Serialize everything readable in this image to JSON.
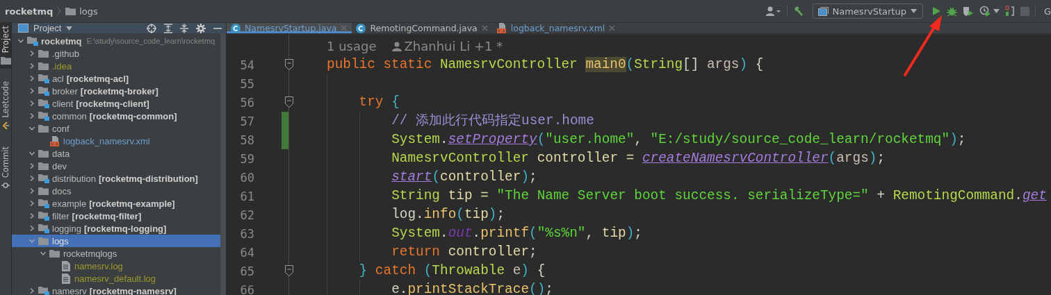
{
  "breadcrumbs": [
    {
      "label": "rocketmq",
      "kind": "project"
    },
    {
      "label": "logs",
      "kind": "folder"
    }
  ],
  "toolbar": {
    "run_configuration": "NamesrvStartup",
    "cut_label": "G"
  },
  "tool_strip": [
    {
      "label": "Project",
      "kind": "project",
      "selected": true
    },
    {
      "label": "Leetcode",
      "kind": "leetcode",
      "selected": false
    },
    {
      "label": "Commit",
      "kind": "commit",
      "selected": false
    }
  ],
  "project_panel": {
    "title": "Project",
    "tree": [
      {
        "name": "rocketmq",
        "path": "E:\\study\\source_code_learn\\rocketmq",
        "kind": "module",
        "color": "#c8c8c8",
        "expanded": true,
        "selected": false,
        "children": [
          {
            "name": ".github",
            "kind": "folder",
            "color": "#bbbbbb",
            "expanded": false,
            "selected": false
          },
          {
            "name": ".idea",
            "kind": "folder",
            "color": "#9a9a2c",
            "expanded": false,
            "selected": false
          },
          {
            "name": "acl",
            "module": "[rocketmq-acl]",
            "kind": "module",
            "color": "#bbbbbb",
            "expanded": false,
            "selected": false
          },
          {
            "name": "broker",
            "module": "[rocketmq-broker]",
            "kind": "module",
            "color": "#bbbbbb",
            "expanded": false,
            "selected": false
          },
          {
            "name": "client",
            "module": "[rocketmq-client]",
            "kind": "module",
            "color": "#bbbbbb",
            "expanded": false,
            "selected": false
          },
          {
            "name": "common",
            "module": "[rocketmq-common]",
            "kind": "module",
            "color": "#bbbbbb",
            "expanded": false,
            "selected": false
          },
          {
            "name": "conf",
            "kind": "folder",
            "color": "#bbbbbb",
            "expanded": true,
            "selected": false,
            "children": [
              {
                "name": "logback_namesrv.xml",
                "kind": "xml",
                "color": "#6d9fce",
                "selected": false
              }
            ]
          },
          {
            "name": "data",
            "kind": "folder",
            "color": "#bbbbbb",
            "expanded": true,
            "selected": false
          },
          {
            "name": "dev",
            "kind": "folder",
            "color": "#bbbbbb",
            "expanded": false,
            "selected": false
          },
          {
            "name": "distribution",
            "module": "[rocketmq-distribution]",
            "kind": "module",
            "color": "#bbbbbb",
            "expanded": false,
            "selected": false
          },
          {
            "name": "docs",
            "kind": "folder",
            "color": "#bbbbbb",
            "expanded": false,
            "selected": false
          },
          {
            "name": "example",
            "module": "[rocketmq-example]",
            "kind": "module",
            "color": "#bbbbbb",
            "expanded": false,
            "selected": false
          },
          {
            "name": "filter",
            "module": "[rocketmq-filter]",
            "kind": "module",
            "color": "#bbbbbb",
            "expanded": false,
            "selected": false
          },
          {
            "name": "logging",
            "module": "[rocketmq-logging]",
            "kind": "module",
            "color": "#bbbbbb",
            "expanded": false,
            "selected": false
          },
          {
            "name": "logs",
            "kind": "folder",
            "expanded": true,
            "selected": true,
            "children": [
              {
                "name": "rocketmqlogs",
                "kind": "folder",
                "color": "#bbbbbb",
                "expanded": true,
                "selected": false,
                "children": [
                  {
                    "name": "namesrv.log",
                    "kind": "log",
                    "color": "#9a9a2c",
                    "selected": false
                  },
                  {
                    "name": "namesrv_default.log",
                    "kind": "log",
                    "color": "#9a9a2c",
                    "selected": false
                  }
                ]
              }
            ]
          },
          {
            "name": "namesrv",
            "module": "[rocketmq-namesrv]",
            "kind": "module",
            "color": "#bbbbbb",
            "expanded": false,
            "selected": false
          }
        ]
      }
    ]
  },
  "editor": {
    "tabs": [
      {
        "label": "NamesrvStartup.java",
        "kind": "java",
        "color": "#6d9fce",
        "selected": true
      },
      {
        "label": "RemotingCommand.java",
        "kind": "java",
        "color": "#bbbbbb",
        "selected": false
      },
      {
        "label": "logback_namesrv.xml",
        "kind": "xml",
        "color": "#6d9fce",
        "selected": false
      }
    ],
    "inlay": {
      "usages": "1 usage",
      "author": "Zhanhui Li +1 *"
    },
    "lines": [
      {
        "number": "54",
        "fold": true,
        "changed": false,
        "tokens": [
          {
            "text": "public static ",
            "kind": "kw"
          },
          {
            "text": "NamesrvController ",
            "kind": "cls"
          },
          {
            "text": "main0",
            "kind": "decl"
          },
          {
            "text": "(",
            "kind": "paren"
          },
          {
            "text": "String",
            "kind": "cls"
          },
          {
            "text": "[] ",
            "kind": "plain"
          },
          {
            "text": "args",
            "kind": "param"
          },
          {
            "text": ")",
            "kind": "paren"
          },
          {
            "text": " {",
            "kind": "plain"
          }
        ],
        "children": [
          {
            "number": "55",
            "fold": false,
            "changed": false
          },
          {
            "number": "56",
            "fold": true,
            "changed": false,
            "tokens": [
              {
                "text": "try ",
                "kind": "kw"
              },
              {
                "text": "{",
                "kind": "paren"
              }
            ],
            "children": [
              {
                "number": "57",
                "fold": false,
                "changed": true,
                "tokens": [
                  {
                    "text": "// 添加此行代码指定user.home",
                    "kind": "comment"
                  }
                ]
              },
              {
                "number": "58",
                "fold": false,
                "changed": true,
                "tokens": [
                  {
                    "text": "System",
                    "kind": "cls"
                  },
                  {
                    "text": ".",
                    "kind": "plain"
                  },
                  {
                    "text": "setProperty",
                    "kind": "static"
                  },
                  {
                    "text": "(",
                    "kind": "paren"
                  },
                  {
                    "text": "\"user.home\"",
                    "kind": "str"
                  },
                  {
                    "text": ", ",
                    "kind": "plain"
                  },
                  {
                    "text": "\"E:/study/source_code_learn/rocketmq\"",
                    "kind": "str"
                  },
                  {
                    "text": ")",
                    "kind": "paren"
                  },
                  {
                    "text": ";",
                    "kind": "plain"
                  }
                ]
              },
              {
                "number": "59",
                "fold": false,
                "changed": false,
                "tokens": [
                  {
                    "text": "NamesrvController",
                    "kind": "cls"
                  },
                  {
                    "text": " controller = ",
                    "kind": "var"
                  },
                  {
                    "text": "createNamesrvController",
                    "kind": "static"
                  },
                  {
                    "text": "(",
                    "kind": "paren"
                  },
                  {
                    "text": "args",
                    "kind": "param"
                  },
                  {
                    "text": ")",
                    "kind": "paren"
                  },
                  {
                    "text": ";",
                    "kind": "plain"
                  }
                ]
              },
              {
                "number": "60",
                "fold": false,
                "changed": false,
                "tokens": [
                  {
                    "text": "start",
                    "kind": "static"
                  },
                  {
                    "text": "(",
                    "kind": "paren"
                  },
                  {
                    "text": "controller",
                    "kind": "var"
                  },
                  {
                    "text": ")",
                    "kind": "paren"
                  },
                  {
                    "text": ";",
                    "kind": "plain"
                  }
                ]
              },
              {
                "number": "61",
                "fold": false,
                "changed": false,
                "tokens": [
                  {
                    "text": "String",
                    "kind": "cls"
                  },
                  {
                    "text": " tip = ",
                    "kind": "var"
                  },
                  {
                    "text": "\"The Name Server boot success. serializeType=\"",
                    "kind": "str"
                  },
                  {
                    "text": " + ",
                    "kind": "plain"
                  },
                  {
                    "text": "RemotingCommand",
                    "kind": "cls"
                  },
                  {
                    "text": ".",
                    "kind": "plain"
                  },
                  {
                    "text": "get",
                    "kind": "static"
                  }
                ]
              },
              {
                "number": "62",
                "fold": false,
                "changed": false,
                "tokens": [
                  {
                    "text": "log.",
                    "kind": "plain"
                  },
                  {
                    "text": "info",
                    "kind": "call"
                  },
                  {
                    "text": "(",
                    "kind": "paren"
                  },
                  {
                    "text": "tip",
                    "kind": "var"
                  },
                  {
                    "text": ")",
                    "kind": "paren"
                  },
                  {
                    "text": ";",
                    "kind": "plain"
                  }
                ]
              },
              {
                "number": "63",
                "fold": false,
                "changed": false,
                "tokens": [
                  {
                    "text": "System",
                    "kind": "cls"
                  },
                  {
                    "text": ".",
                    "kind": "plain"
                  },
                  {
                    "text": "out",
                    "kind": "field"
                  },
                  {
                    "text": ".",
                    "kind": "plain"
                  },
                  {
                    "text": "printf",
                    "kind": "call"
                  },
                  {
                    "text": "(",
                    "kind": "paren"
                  },
                  {
                    "text": "\"%s%n\"",
                    "kind": "str"
                  },
                  {
                    "text": ", ",
                    "kind": "plain"
                  },
                  {
                    "text": "tip",
                    "kind": "var"
                  },
                  {
                    "text": ")",
                    "kind": "paren"
                  },
                  {
                    "text": ";",
                    "kind": "plain"
                  }
                ]
              },
              {
                "number": "64",
                "fold": false,
                "changed": false,
                "tokens": [
                  {
                    "text": "return ",
                    "kind": "kw"
                  },
                  {
                    "text": "controller",
                    "kind": "var"
                  },
                  {
                    "text": ";",
                    "kind": "plain"
                  }
                ]
              }
            ]
          },
          {
            "number": "65",
            "fold": true,
            "changed": false,
            "tokens": [
              {
                "text": "}",
                "kind": "paren"
              },
              {
                "text": " catch ",
                "kind": "kw"
              },
              {
                "text": "(",
                "kind": "paren"
              },
              {
                "text": "Throwable",
                "kind": "cls"
              },
              {
                "text": " e",
                "kind": "param"
              },
              {
                "text": ")",
                "kind": "paren"
              },
              {
                "text": " {",
                "kind": "plain"
              }
            ],
            "children": [
              {
                "number": "66",
                "fold": false,
                "changed": false,
                "tokens": [
                  {
                    "text": "e.",
                    "kind": "plain"
                  },
                  {
                    "text": "printStackTrace",
                    "kind": "call"
                  },
                  {
                    "text": "()",
                    "kind": "paren"
                  },
                  {
                    "text": ";",
                    "kind": "plain"
                  }
                ]
              }
            ]
          }
        ]
      }
    ]
  }
}
